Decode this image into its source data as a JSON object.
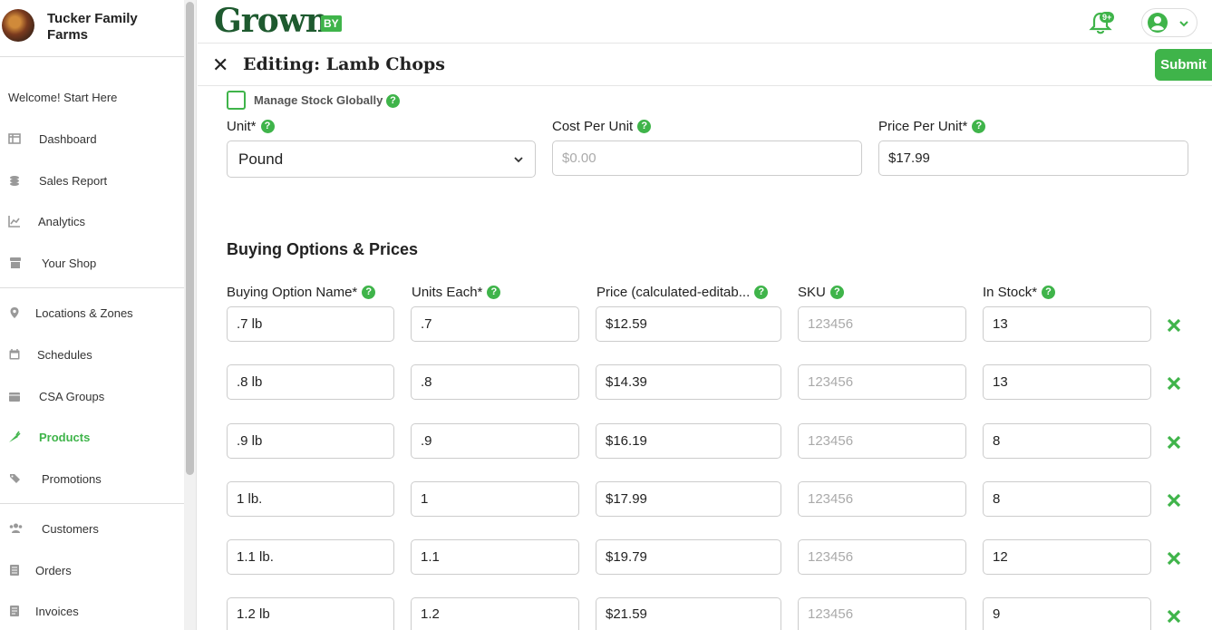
{
  "sidebar": {
    "farm_name": "Tucker Family Farms",
    "welcome": "Welcome! Start Here",
    "items": [
      {
        "label": "Dashboard",
        "icon": "dashboard-icon"
      },
      {
        "label": "Sales Report",
        "icon": "coins-icon"
      },
      {
        "label": "Analytics",
        "icon": "chart-line-icon"
      },
      {
        "label": "Your Shop",
        "icon": "store-icon"
      },
      {
        "label": "Locations & Zones",
        "icon": "map-pin-icon"
      },
      {
        "label": "Schedules",
        "icon": "calendar-icon"
      },
      {
        "label": "CSA Groups",
        "icon": "box-icon"
      },
      {
        "label": "Products",
        "icon": "carrot-icon",
        "active": true
      },
      {
        "label": "Promotions",
        "icon": "tags-icon"
      },
      {
        "label": "Customers",
        "icon": "users-icon"
      },
      {
        "label": "Orders",
        "icon": "list-icon"
      },
      {
        "label": "Invoices",
        "icon": "invoice-icon"
      }
    ]
  },
  "header": {
    "brand": "Grown",
    "brand_suffix": "BY",
    "notifications_badge": "9+"
  },
  "editor": {
    "title": "Editing: Lamb Chops",
    "submit_label": "Submit",
    "manage_stock_label": "Manage Stock Globally",
    "unit_label": "Unit*",
    "unit_value": "Pound",
    "cost_label": "Cost Per Unit",
    "cost_placeholder": "$0.00",
    "price_label": "Price Per Unit*",
    "price_value": "$17.99"
  },
  "buying_options": {
    "title": "Buying Options & Prices",
    "headers": [
      "Buying Option Name*",
      "Units Each*",
      "Price (calculated-editab...",
      "SKU",
      "In Stock*"
    ],
    "sku_placeholder": "123456",
    "rows": [
      {
        "name": ".7 lb",
        "units": ".7",
        "price": "$12.59",
        "stock": "13"
      },
      {
        "name": ".8 lb",
        "units": ".8",
        "price": "$14.39",
        "stock": "13"
      },
      {
        "name": ".9 lb",
        "units": ".9",
        "price": "$16.19",
        "stock": "8"
      },
      {
        "name": "1 lb.",
        "units": "1",
        "price": "$17.99",
        "stock": "8"
      },
      {
        "name": "1.1 lb.",
        "units": "1.1",
        "price": "$19.79",
        "stock": "12"
      },
      {
        "name": "1.2 lb",
        "units": "1.2",
        "price": "$21.59",
        "stock": "9"
      }
    ]
  },
  "colors": {
    "accent": "#3fb44a",
    "brand_dark": "#1e5a2f"
  }
}
